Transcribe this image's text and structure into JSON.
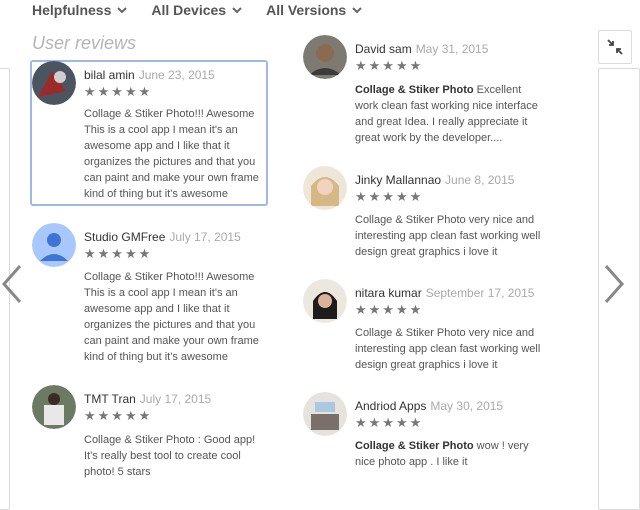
{
  "filters": [
    {
      "label": "Helpfulness"
    },
    {
      "label": "All Devices"
    },
    {
      "label": "All Versions"
    }
  ],
  "section_title": "User reviews",
  "reviews": [
    {
      "author": "bilal amin",
      "date": "June 23, 2015",
      "stars": "★★★★★",
      "app": "",
      "text": "Collage & Stiker Photo!!! Awesome This is a cool app I mean it's an awesome app and I like that it organizes the pictures and that you can paint and make your own frame kind of thing but it's awesome"
    },
    {
      "author": "Studio GMFree",
      "date": "July 17, 2015",
      "stars": "★★★★★",
      "app": "",
      "text": "Collage & Stiker Photo!!! Awesome This is a cool app I mean it's an awesome app and I like that it organizes the pictures and that you can paint and make your own frame kind of thing but it's awesome"
    },
    {
      "author": "TMT Tran",
      "date": "July 17, 2015",
      "stars": "★★★★★",
      "app": "",
      "text": "Collage & Stiker Photo : Good app! It's really best tool to create cool photo! 5 stars"
    },
    {
      "author": "David sam",
      "date": "May 31, 2015",
      "stars": "★★★★★",
      "app": "Collage & Stiker Photo",
      "text": "Excellent work clean fast working nice interface and great Idea. I really appreciate it great work by the developer...."
    },
    {
      "author": "Jinky Mallannao",
      "date": "June 8, 2015",
      "stars": "★★★★★",
      "app": "",
      "text": "Collage & Stiker Photo very nice and interesting app clean fast working well design great graphics i love it"
    },
    {
      "author": "nitara kumar",
      "date": "September 17, 2015",
      "stars": "★★★★★",
      "app": "",
      "text": "Collage & Stiker Photo very nice and interesting app clean fast working well design great graphics i love it"
    },
    {
      "author": "Andriod Apps",
      "date": "May 30, 2015",
      "stars": "★★★★★",
      "app": "Collage & Stiker Photo",
      "text": "wow ! very nice photo app . I like it"
    }
  ]
}
